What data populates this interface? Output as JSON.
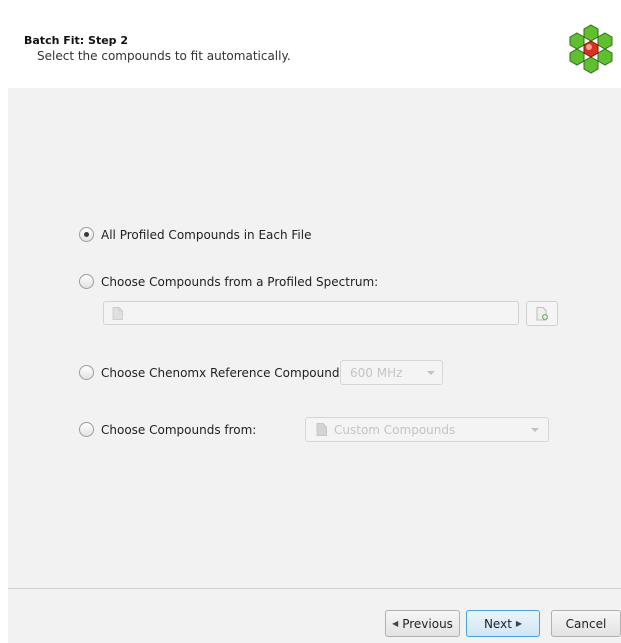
{
  "header": {
    "title": "Batch Fit: Step 2",
    "subtitle": "Select the compounds to fit automatically."
  },
  "options": {
    "all_profiled": "All Profiled Compounds in Each File",
    "from_spectrum": "Choose Compounds from a Profiled Spectrum:",
    "reference": "Choose Chenomx Reference Compounds:",
    "from_source": "Choose Compounds from:"
  },
  "reference_frequency": {
    "selected": "600 MHz"
  },
  "source_library": {
    "selected": "Custom Compounds"
  },
  "buttons": {
    "previous": "Previous",
    "next": "Next",
    "cancel": "Cancel"
  },
  "icons": {
    "logo": "hexagon-cluster-logo-icon",
    "spectrum_file": "document-icon",
    "browse": "add-file-icon",
    "library": "document-icon",
    "previous": "triangle-left-icon",
    "next": "triangle-right-icon"
  },
  "selected_option": "all_profiled"
}
